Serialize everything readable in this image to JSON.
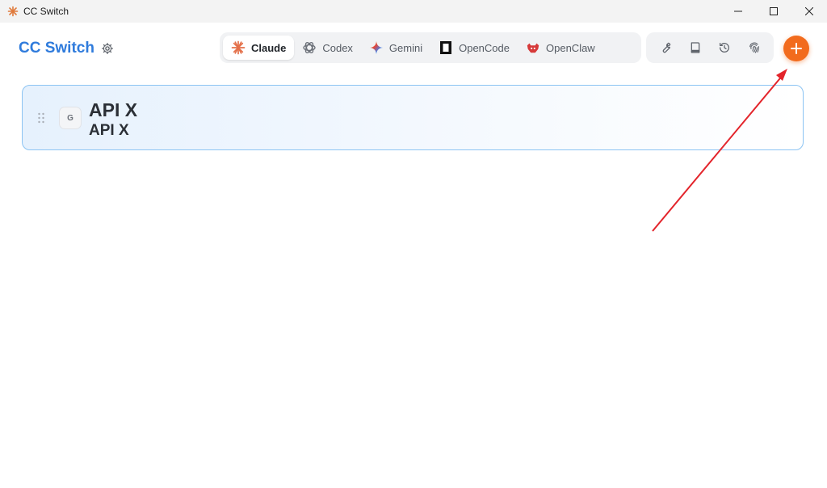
{
  "window": {
    "title": "CC Switch",
    "controls": [
      "minimize",
      "maximize",
      "close"
    ]
  },
  "header": {
    "brand": "CC Switch",
    "tabs": [
      {
        "label": "Claude",
        "icon": "claude-icon",
        "active": true
      },
      {
        "label": "Codex",
        "icon": "codex-icon",
        "active": false
      },
      {
        "label": "Gemini",
        "icon": "gemini-icon",
        "active": false
      },
      {
        "label": "OpenCode",
        "icon": "opencode-icon",
        "active": false
      },
      {
        "label": "OpenClaw",
        "icon": "openclaw-icon",
        "active": false
      }
    ],
    "tools": [
      "wrench-icon",
      "book-icon",
      "history-icon",
      "fingerprint-icon"
    ],
    "add_icon": "plus-icon"
  },
  "providers": [
    {
      "badge": "G",
      "name": "API X",
      "subtitle": "API X",
      "selected": true
    }
  ],
  "colors": {
    "brand": "#2f7bdc",
    "accent": "#f26b1d",
    "card_border": "#8cc4f3",
    "annotation": "#e3242b"
  }
}
